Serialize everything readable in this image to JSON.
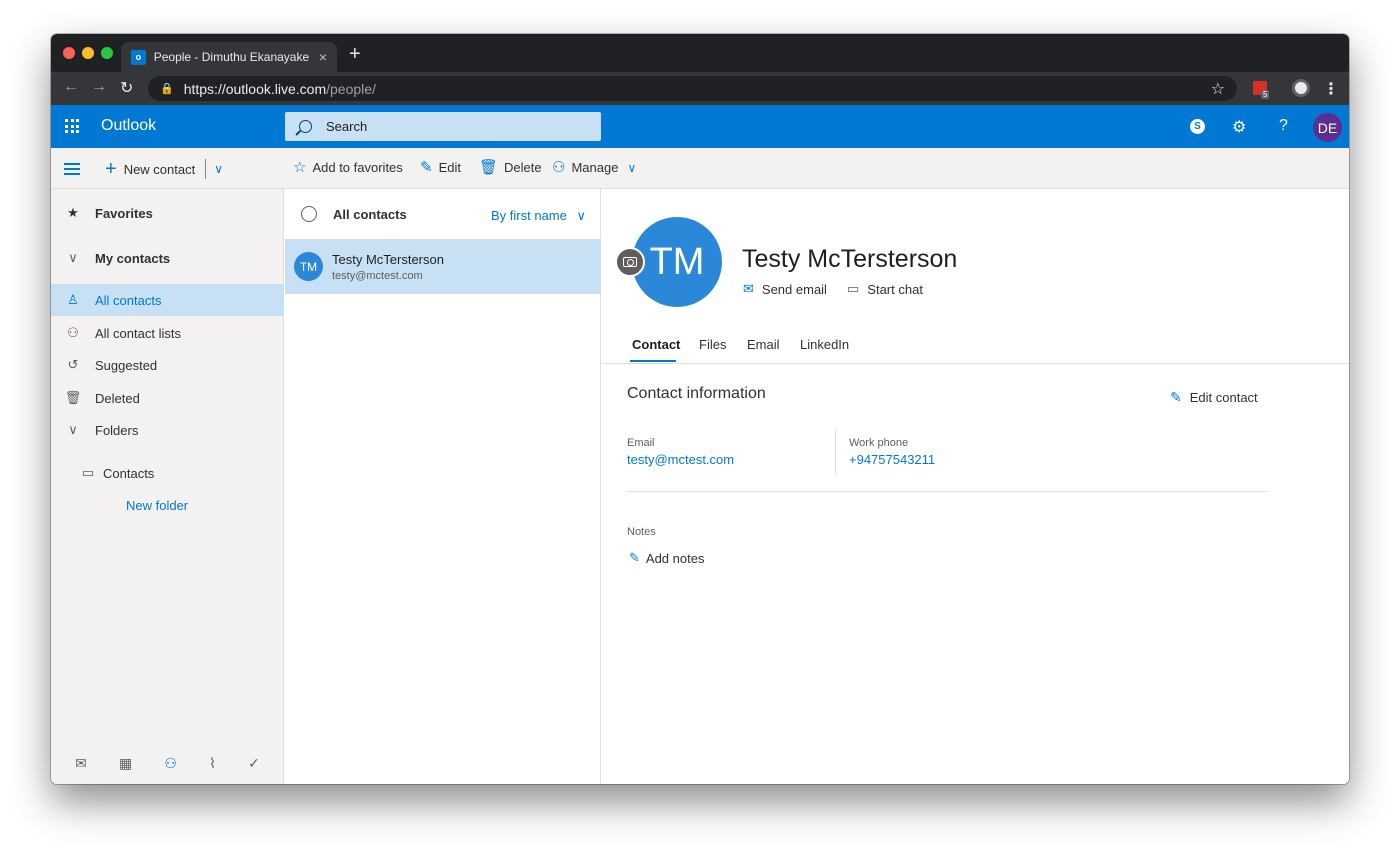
{
  "browser": {
    "tab_title": "People - Dimuthu Ekanayake -",
    "tab_close": "×",
    "new_tab": "+",
    "url_host": "https://outlook.live.com",
    "url_path": "/people/",
    "extension_badge": "5"
  },
  "header": {
    "app_name": "Outlook",
    "search_placeholder": "Search",
    "help": "?",
    "user_initials": "DE"
  },
  "commandbar": {
    "new_contact": "New contact",
    "add_to_favorites": "Add to favorites",
    "edit": "Edit",
    "delete": "Delete",
    "manage": "Manage"
  },
  "leftnav": {
    "favorites": "Favorites",
    "my_contacts": "My contacts",
    "all_contacts": "All contacts",
    "all_contact_lists": "All contact lists",
    "suggested": "Suggested",
    "deleted": "Deleted",
    "folders": "Folders",
    "contacts_folder": "Contacts",
    "new_folder": "New folder",
    "bottom_icons": [
      "mail-icon",
      "calendar-icon",
      "people-icon",
      "attachment-icon",
      "tasks-icon"
    ]
  },
  "list": {
    "title": "All contacts",
    "sort": "By first name",
    "contacts": [
      {
        "initials": "TM",
        "name": "Testy McTersterson",
        "email": "testy@mctest.com"
      }
    ]
  },
  "detail": {
    "initials": "TM",
    "name": "Testy McTersterson",
    "send_email": "Send email",
    "start_chat": "Start chat",
    "tabs": [
      "Contact",
      "Files",
      "Email",
      "LinkedIn"
    ],
    "active_tab": "Contact",
    "section_title": "Contact information",
    "edit_contact": "Edit contact",
    "email_label": "Email",
    "email_value": "testy@mctest.com",
    "phone_label": "Work phone",
    "phone_value": "+94757543211",
    "notes_label": "Notes",
    "add_notes": "Add notes"
  },
  "colors": {
    "brand": "#0078d4",
    "selected": "#c7e0f4",
    "avatar": "#2b88d8",
    "user_avatar": "#5c2e91"
  }
}
